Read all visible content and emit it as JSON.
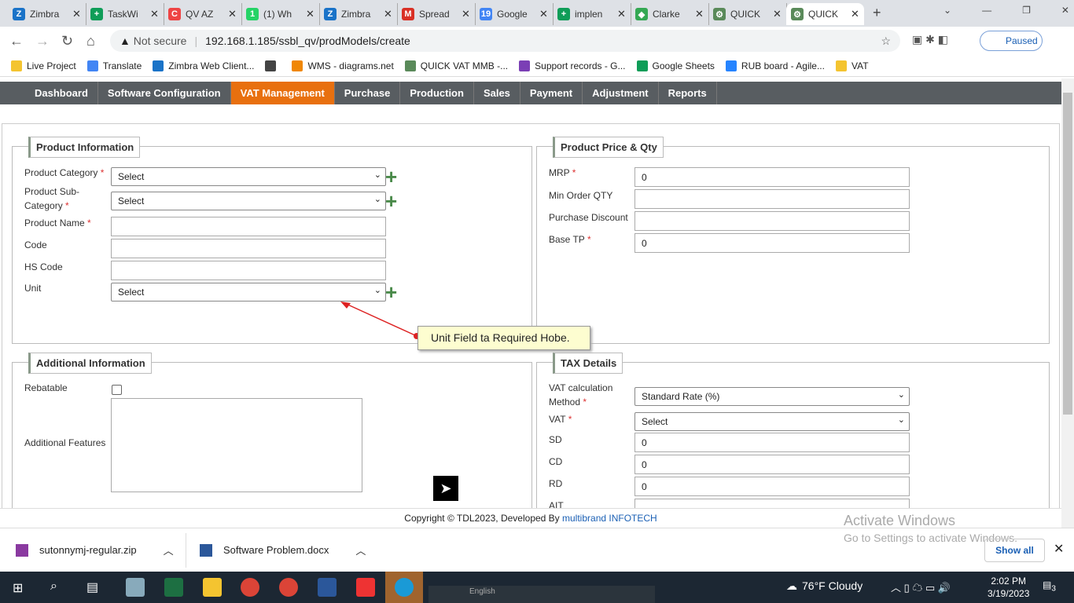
{
  "browser": {
    "tabs": [
      {
        "title": "Zimbra",
        "color": "#1a73c8",
        "glyph": "Z"
      },
      {
        "title": "TaskWi",
        "color": "#0f9d58",
        "glyph": "+"
      },
      {
        "title": "QV AZ",
        "color": "#e44",
        "glyph": "C"
      },
      {
        "title": "(1) Wh",
        "color": "#25d366",
        "glyph": "1"
      },
      {
        "title": "Zimbra",
        "color": "#1a73c8",
        "glyph": "Z"
      },
      {
        "title": "Spread",
        "color": "#d93025",
        "glyph": "M"
      },
      {
        "title": "Google",
        "color": "#4285f4",
        "glyph": "19"
      },
      {
        "title": "implen",
        "color": "#0f9d58",
        "glyph": "+"
      },
      {
        "title": "Clarke",
        "color": "#34a853",
        "glyph": "◆"
      },
      {
        "title": "QUICK",
        "color": "#5a8a5a",
        "glyph": "⚙"
      },
      {
        "title": "QUICK",
        "color": "#5a8a5a",
        "glyph": "⚙"
      }
    ],
    "not_secure": "Not secure",
    "url": "192.168.1.185/ssbl_qv/prodModels/create",
    "profile": "Paused",
    "bookmarks": [
      {
        "label": "Live Project",
        "color": "#f4c430"
      },
      {
        "label": "Translate",
        "color": "#4285f4"
      },
      {
        "label": "Zimbra Web Client...",
        "color": "#1a73c8"
      },
      {
        "label": "",
        "color": "#444"
      },
      {
        "label": "WMS - diagrams.net",
        "color": "#f08705"
      },
      {
        "label": "QUICK VAT MMB -...",
        "color": "#5a8a5a"
      },
      {
        "label": "Support records - G...",
        "color": "#7b3fb5"
      },
      {
        "label": "Google Sheets",
        "color": "#0f9d58"
      },
      {
        "label": "RUB board - Agile...",
        "color": "#2684ff"
      },
      {
        "label": "VAT",
        "color": "#f4c430"
      }
    ]
  },
  "menu": [
    "Dashboard",
    "Software Configuration",
    "VAT Management",
    "Purchase",
    "Production",
    "Sales",
    "Payment",
    "Adjustment",
    "Reports"
  ],
  "product_info": {
    "title": "Product Information",
    "category_label": "Product Category",
    "category_value": "Select",
    "subcat_label_1": "Product Sub-",
    "subcat_label_2": "Category",
    "subcat_value": "Select",
    "name_label": "Product Name",
    "code_label": "Code",
    "hs_label": "HS Code",
    "unit_label": "Unit",
    "unit_value": "Select",
    "required_mark": "*"
  },
  "price": {
    "title": "Product Price & Qty",
    "mrp_label": "MRP",
    "mrp": "0",
    "min_label": "Min Order QTY",
    "min": "",
    "disc_label": "Purchase Discount",
    "disc": "",
    "tp_label": "Base TP",
    "tp": "0"
  },
  "annotation": "Unit Field ta Required Hobe.",
  "additional": {
    "title": "Additional Information",
    "rebatable": "Rebatable",
    "features": "Additional Features"
  },
  "tax": {
    "title": "TAX Details",
    "method_label_1": "VAT calculation",
    "method_label_2": "Method",
    "method": "Standard Rate (%)",
    "vat_label": "VAT",
    "vat": "Select",
    "sd_label": "SD",
    "sd": "0",
    "cd_label": "CD",
    "cd": "0",
    "rd_label": "RD",
    "rd": "0",
    "ait_label": "AIT"
  },
  "footer": {
    "text": "Copyright © TDL2023, Developed By ",
    "link": "multibrand INFOTECH"
  },
  "downloads": [
    {
      "name": "sutonnymj-regular.zip"
    },
    {
      "name": "Software Problem.docx"
    }
  ],
  "show_all": "Show all",
  "activate": {
    "title": "Activate Windows",
    "sub": "Go to Settings to activate Windows."
  },
  "taskbar": {
    "weather": "76°F  Cloudy",
    "time": "2:02 PM",
    "date": "3/19/2023",
    "lang": "English",
    "notif": "3"
  }
}
